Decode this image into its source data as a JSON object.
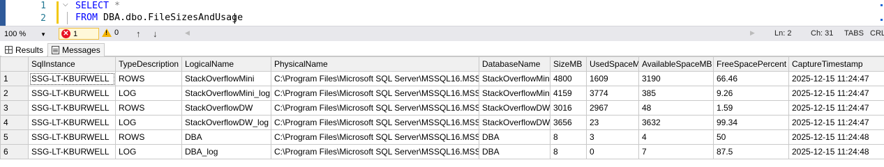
{
  "editor": {
    "line_numbers": [
      "1",
      "2"
    ],
    "line1": {
      "kw": "SELECT",
      "rest": " *"
    },
    "line2": {
      "kw": "FROM",
      "rest": " DBA.dbo.FileSizesAndUsage"
    }
  },
  "status": {
    "zoom": "100 %",
    "errors": "1",
    "warnings": "0",
    "up_arrow": "↑",
    "down_arrow": "↓",
    "line": "Ln: 2",
    "col": "Ch: 31",
    "tabs_mode": "TABS",
    "eol": "CRL"
  },
  "tabs": {
    "results": "Results",
    "messages": "Messages"
  },
  "grid": {
    "columns": [
      "SqlInstance",
      "TypeDescription",
      "LogicalName",
      "PhysicalName",
      "DatabaseName",
      "SizeMB",
      "UsedSpaceMB",
      "AvailableSpaceMB",
      "FreeSpacePercent",
      "CaptureTimestamp"
    ],
    "rows": [
      [
        "1",
        "SSG-LT-KBURWELL",
        "ROWS",
        "StackOverflowMini",
        "C:\\Program Files\\Microsoft SQL Server\\MSSQL16.MSS...",
        "StackOverflowMini",
        "4800",
        "1609",
        "3190",
        "66.46",
        "2025-12-15 11:24:47"
      ],
      [
        "2",
        "SSG-LT-KBURWELL",
        "LOG",
        "StackOverflowMini_log",
        "C:\\Program Files\\Microsoft SQL Server\\MSSQL16.MSS...",
        "StackOverflowMini",
        "4159",
        "3774",
        "385",
        "9.26",
        "2025-12-15 11:24:47"
      ],
      [
        "3",
        "SSG-LT-KBURWELL",
        "ROWS",
        "StackOverflowDW",
        "C:\\Program Files\\Microsoft SQL Server\\MSSQL16.MSS...",
        "StackOverflowDW",
        "3016",
        "2967",
        "48",
        "1.59",
        "2025-12-15 11:24:47"
      ],
      [
        "4",
        "SSG-LT-KBURWELL",
        "LOG",
        "StackOverflowDW_log",
        "C:\\Program Files\\Microsoft SQL Server\\MSSQL16.MSS...",
        "StackOverflowDW",
        "3656",
        "23",
        "3632",
        "99.34",
        "2025-12-15 11:24:47"
      ],
      [
        "5",
        "SSG-LT-KBURWELL",
        "ROWS",
        "DBA",
        "C:\\Program Files\\Microsoft SQL Server\\MSSQL16.MSS...",
        "DBA",
        "8",
        "3",
        "4",
        "50",
        "2025-12-15 11:24:48"
      ],
      [
        "6",
        "SSG-LT-KBURWELL",
        "LOG",
        "DBA_log",
        "C:\\Program Files\\Microsoft SQL Server\\MSSQL16.MSS...",
        "DBA",
        "8",
        "0",
        "7",
        "87.5",
        "2025-12-15 11:24:48"
      ]
    ]
  }
}
